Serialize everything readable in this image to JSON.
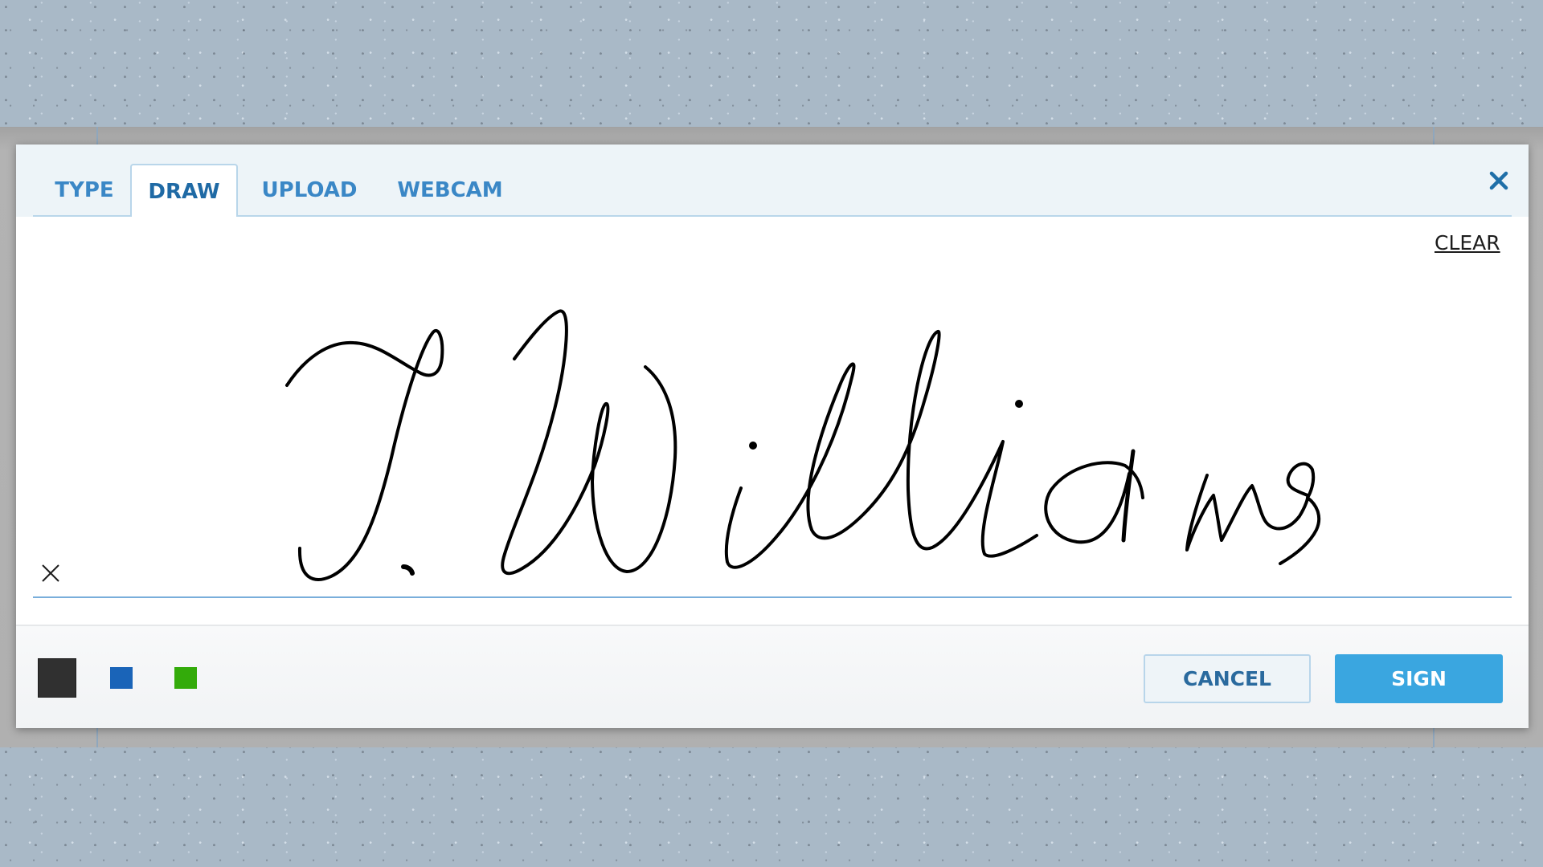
{
  "dialog": {
    "tabs": [
      {
        "label": "TYPE",
        "active": false
      },
      {
        "label": "DRAW",
        "active": true
      },
      {
        "label": "UPLOAD",
        "active": false
      },
      {
        "label": "WEBCAM",
        "active": false
      }
    ],
    "close_icon": "close-icon",
    "clear_label": "CLEAR",
    "signature_marker_icon": "x-mark-icon",
    "signature_text": "J. Williams",
    "ink_color": "#000000",
    "colors": [
      {
        "name": "black",
        "hex": "#303030",
        "selected": true
      },
      {
        "name": "blue",
        "hex": "#1a64b8",
        "selected": false
      },
      {
        "name": "green",
        "hex": "#33ab0a",
        "selected": false
      }
    ],
    "cancel_label": "CANCEL",
    "sign_label": "SIGN",
    "accent_color": "#3aa6e0",
    "tab_text_color": "#3a87c6"
  }
}
